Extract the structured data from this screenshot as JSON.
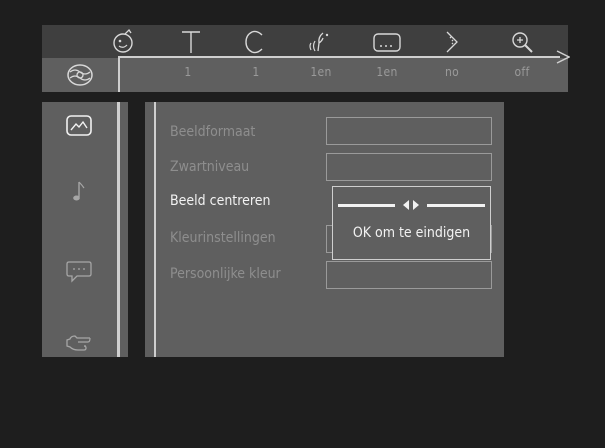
{
  "top_bar": {
    "icons": [
      "title-icon",
      "track-icon",
      "chapter-icon",
      "audio-icon",
      "subtitle-icon",
      "angle-icon",
      "zoom-icon"
    ],
    "values": [
      "1",
      "1",
      "1en",
      "1en",
      "no",
      "off"
    ],
    "disc_icon": "disc-icon"
  },
  "left_menu": {
    "items": [
      "picture-icon",
      "audio-note-icon",
      "subtitle-menu-icon",
      "exit-hand-icon"
    ]
  },
  "panel": {
    "options": [
      {
        "label": "Beeldformaat",
        "active": false
      },
      {
        "label": "Zwartniveau",
        "active": false
      },
      {
        "label": "Beeld centreren",
        "active": true
      },
      {
        "label": "Kleurinstellingen",
        "active": false
      },
      {
        "label": "Persoonlijke kleur",
        "active": false
      }
    ],
    "popup": {
      "slider_icon": "left-right-arrows-icon",
      "hint": "OK om te eindigen"
    }
  },
  "colors": {
    "background": "#1e1e1e",
    "panel": "#5f5f5f",
    "topbar_dark": "#3f3f3f",
    "line": "#cfcfcf",
    "text_dim": "#8e8e8e",
    "text_active": "#f2f2f2"
  }
}
